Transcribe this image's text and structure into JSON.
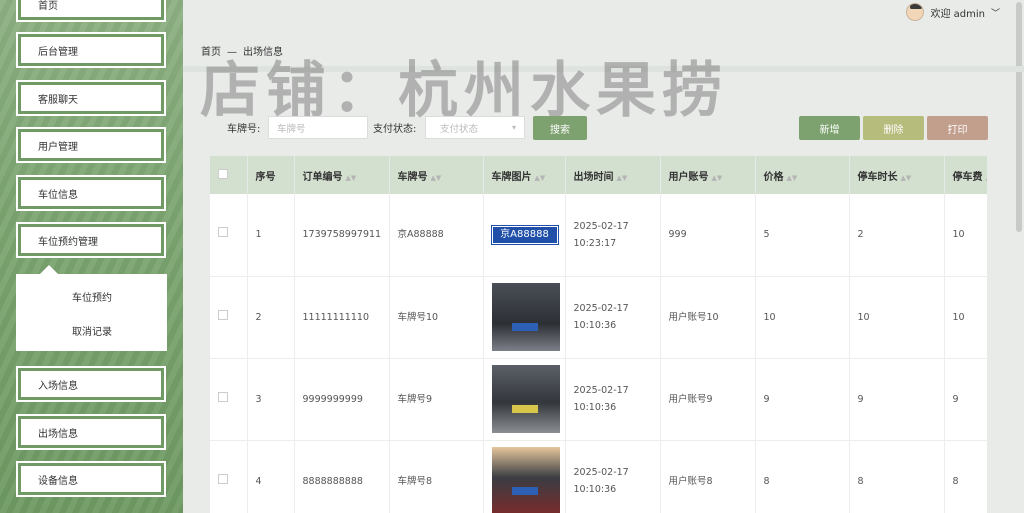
{
  "sidebar": {
    "items": [
      {
        "label": "首页"
      },
      {
        "label": "后台管理"
      },
      {
        "label": "客服聊天"
      },
      {
        "label": "用户管理"
      },
      {
        "label": "车位信息"
      },
      {
        "label": "车位预约管理"
      },
      {
        "label": "入场信息"
      },
      {
        "label": "出场信息"
      },
      {
        "label": "设备信息"
      }
    ],
    "submenu": [
      {
        "label": "车位预约"
      },
      {
        "label": "取消记录"
      }
    ]
  },
  "header": {
    "user_greeting": "欢迎 admin",
    "watermark": "店铺：杭州水果捞"
  },
  "breadcrumb": {
    "home": "首页",
    "sep": "—",
    "current": "出场信息"
  },
  "search": {
    "plate_label": "车牌号:",
    "plate_placeholder": "车牌号",
    "pay_label": "支付状态:",
    "pay_placeholder": "支付状态",
    "search_btn": "搜索"
  },
  "actions": {
    "add": "新增",
    "delete": "删除",
    "print": "打印"
  },
  "colors": {
    "search": "#7ea26f",
    "add": "#7ea26f",
    "delete": "#b5bc7c",
    "print": "#c29f8d",
    "header_bg": "#d3dfcf"
  },
  "table": {
    "headers": [
      "序号",
      "订单编号",
      "车牌号",
      "车牌图片",
      "出场时间",
      "用户账号",
      "价格",
      "停车时长",
      "停车费"
    ],
    "rows": [
      {
        "idx": "1",
        "order": "1739758997911",
        "plate": "京A88888",
        "img": "京A88888",
        "time": "2025-02-17 10:23:17",
        "user": "999",
        "price": "5",
        "duration": "2",
        "fee": "10"
      },
      {
        "idx": "2",
        "order": "11111111110",
        "plate": "车牌号10",
        "img": "",
        "time": "2025-02-17 10:10:36",
        "user": "用户账号10",
        "price": "10",
        "duration": "10",
        "fee": "10"
      },
      {
        "idx": "3",
        "order": "9999999999",
        "plate": "车牌号9",
        "img": "",
        "time": "2025-02-17 10:10:36",
        "user": "用户账号9",
        "price": "9",
        "duration": "9",
        "fee": "9"
      },
      {
        "idx": "4",
        "order": "8888888888",
        "plate": "车牌号8",
        "img": "",
        "time": "2025-02-17 10:10:36",
        "user": "用户账号8",
        "price": "8",
        "duration": "8",
        "fee": "8"
      }
    ]
  }
}
